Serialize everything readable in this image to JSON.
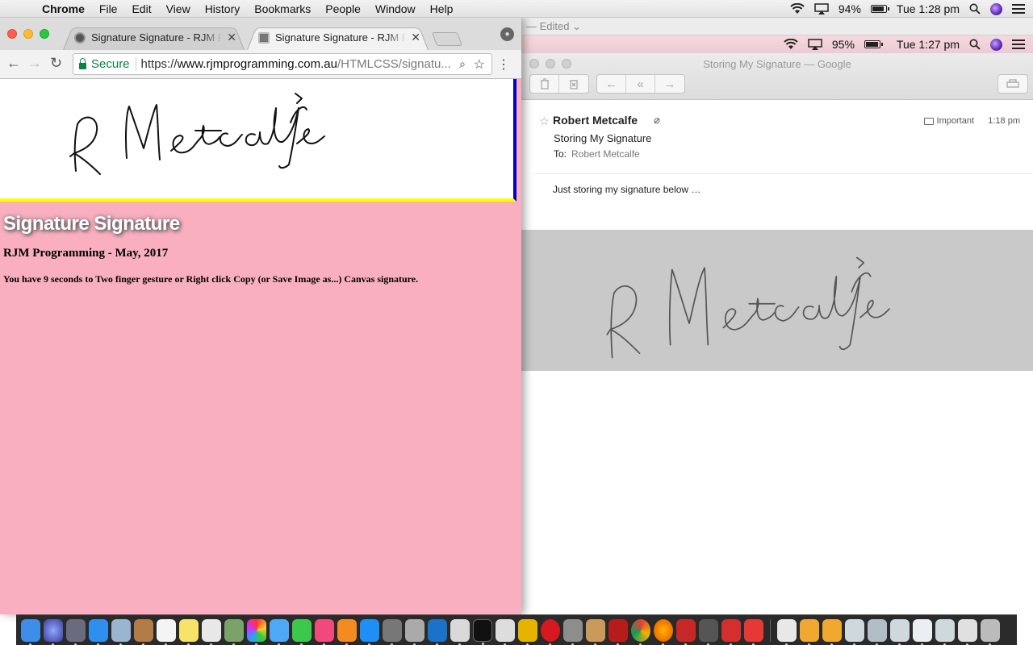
{
  "menubar": {
    "app": "Chrome",
    "items": [
      "File",
      "Edit",
      "View",
      "History",
      "Bookmarks",
      "People",
      "Window",
      "Help"
    ],
    "battery": "94%",
    "clock": "Tue 1:28 pm"
  },
  "bg_window": {
    "edited_label": "— Edited ⌄",
    "battery": "95%",
    "clock": "Tue 1:27 pm"
  },
  "chrome": {
    "tabs": [
      {
        "label": "Signature Signature - RJM Programming"
      },
      {
        "label": "Signature Signature - RJM Programming"
      }
    ],
    "secure_label": "Secure",
    "url_scheme": "https://",
    "url_host": "www.rjmprogramming.com.au",
    "url_path": "/HTMLCSS/signatu...",
    "page": {
      "heading": "Signature Signature",
      "byline": "RJM Programming - May, 2017",
      "instructions": "You have 9 seconds to Two finger gesture or Right click Copy (or Save Image as...) Canvas signature."
    }
  },
  "mail": {
    "window_title": "Storing My Signature — Google",
    "from": "Robert Metcalfe",
    "subject": "Storing My Signature",
    "to_label": "To:",
    "to_name": "Robert Metcalfe",
    "mailbox": "Important",
    "time": "1:18 pm",
    "body": "Just storing my signature below …"
  },
  "colors": {
    "page_background": "#f9afc0",
    "canvas_border_right": "#0000cc",
    "canvas_border_bottom": "#ffff00",
    "secure_green": "#0b8043",
    "signature_image_background": "#c9c9c9"
  }
}
